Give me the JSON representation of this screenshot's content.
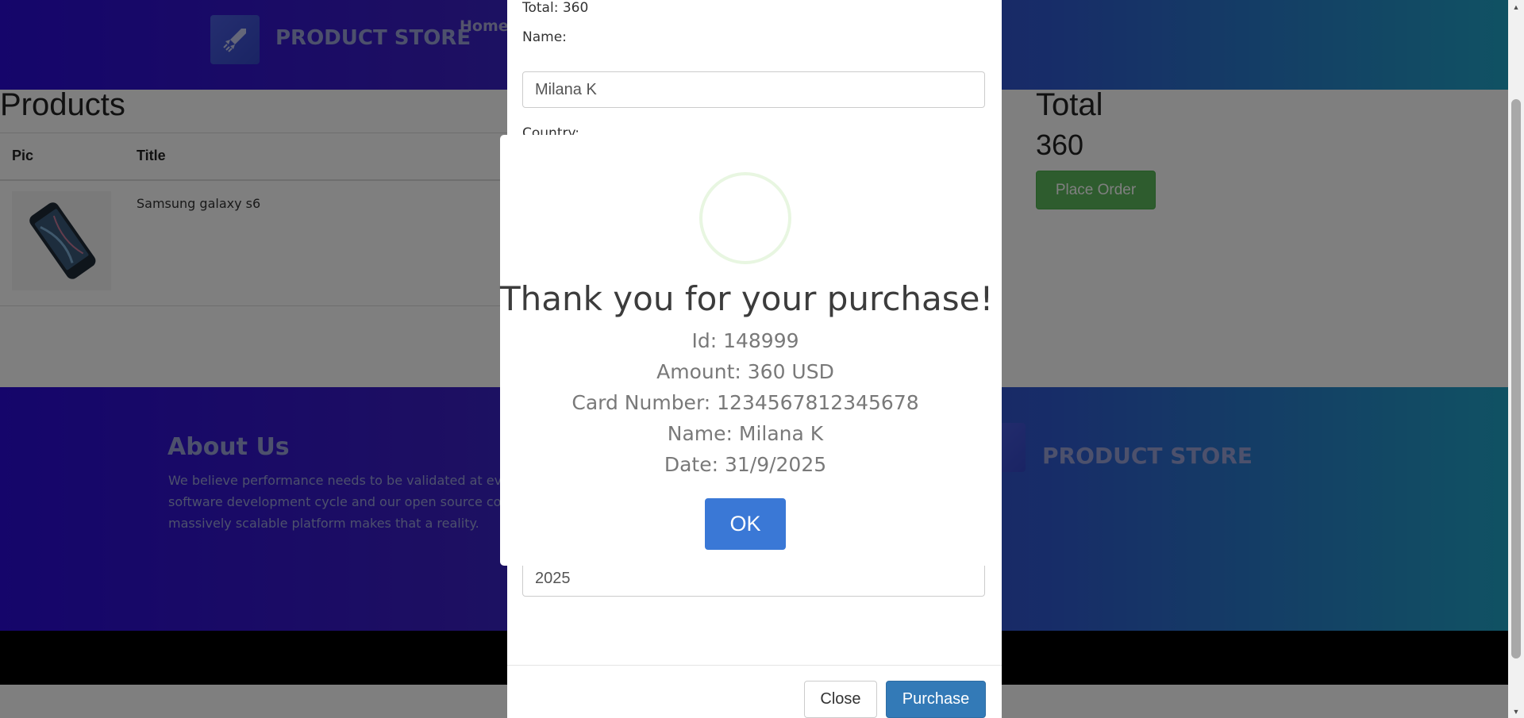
{
  "navbar": {
    "brand": "PRODUCT STORE",
    "home_link": "Home"
  },
  "cart": {
    "products_heading": "Products",
    "columns": [
      "Pic",
      "Title"
    ],
    "rows": [
      {
        "title": "Samsung galaxy s6"
      }
    ],
    "total_heading": "Total",
    "total_value": "360",
    "place_order_label": "Place Order"
  },
  "footer": {
    "about_title": "About Us",
    "about_text": "We believe performance needs to be validated at ev software development cycle and our open source co massively scalable platform makes that a reality.",
    "brand": "PRODUCT STORE"
  },
  "order_modal": {
    "total_line": "Total: 360",
    "name_label": "Name:",
    "name_value": "Milana K",
    "country_label": "Country:",
    "year_value": "2025",
    "close_label": "Close",
    "purchase_label": "Purchase"
  },
  "alert": {
    "title": "Thank you for your purchase!",
    "id_line": "Id: 148999",
    "amount_line": "Amount: 360 USD",
    "card_line": "Card Number: 1234567812345678",
    "name_line": "Name: Milana K",
    "date_line": "Date: 31/9/2025",
    "ok_label": "OK",
    "success_color": "#a5dc86",
    "ok_color": "#3a78d6"
  },
  "colors": {
    "brand_gradient_start": "#2a0bd6",
    "brand_gradient_end": "#21a4c7",
    "place_order_green": "#5cb85c",
    "purchase_blue": "#337ab7"
  }
}
